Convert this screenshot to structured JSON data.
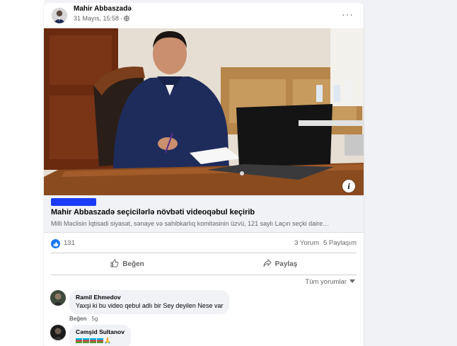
{
  "post": {
    "author": "Mahir Abbaszadə",
    "date": "31 Mayıs, 15:58",
    "dot": "·",
    "privacy_icon": "globe-icon",
    "more_icon": "ellipsis-icon",
    "more_label": "···"
  },
  "image": {
    "info_label": "i"
  },
  "link_preview": {
    "source_redacted": true,
    "title": "Mahir Abbaszadə seçicilərlə növbəti videoqəbul keçirib",
    "description": "Milli Məclisin İqtisadi siyasət, sənaye və sahibkarlıq komitəsinin üzvü, 121 saylı Laçın seçki daire…"
  },
  "reactions": {
    "like_icon": "thumbs-up-icon",
    "count": "131",
    "comments": "3 Yorum",
    "shares": "5 Paylaşım"
  },
  "actions": {
    "like_label": "Beğen",
    "share_label": "Paylaş"
  },
  "comments_sort": {
    "label": "Tüm yorumlar",
    "icon": "caret-down-icon"
  },
  "comments": [
    {
      "author": "Ramil Ehmedov",
      "text": "Yaxşi ki bu video qebul adlı bir Sey deyilen Nese var",
      "like_label": "Beğen",
      "time": "5g"
    },
    {
      "author": "Cəmşid Sultanov",
      "text": "",
      "emoji": "🇦🇿🇦🇿🇦🇿🇦🇿🙏"
    }
  ],
  "colors": {
    "accent": "#1877f2",
    "background": "#f0f2f5",
    "secondary_text": "#65676b",
    "redaction": "#1a3cf5"
  }
}
